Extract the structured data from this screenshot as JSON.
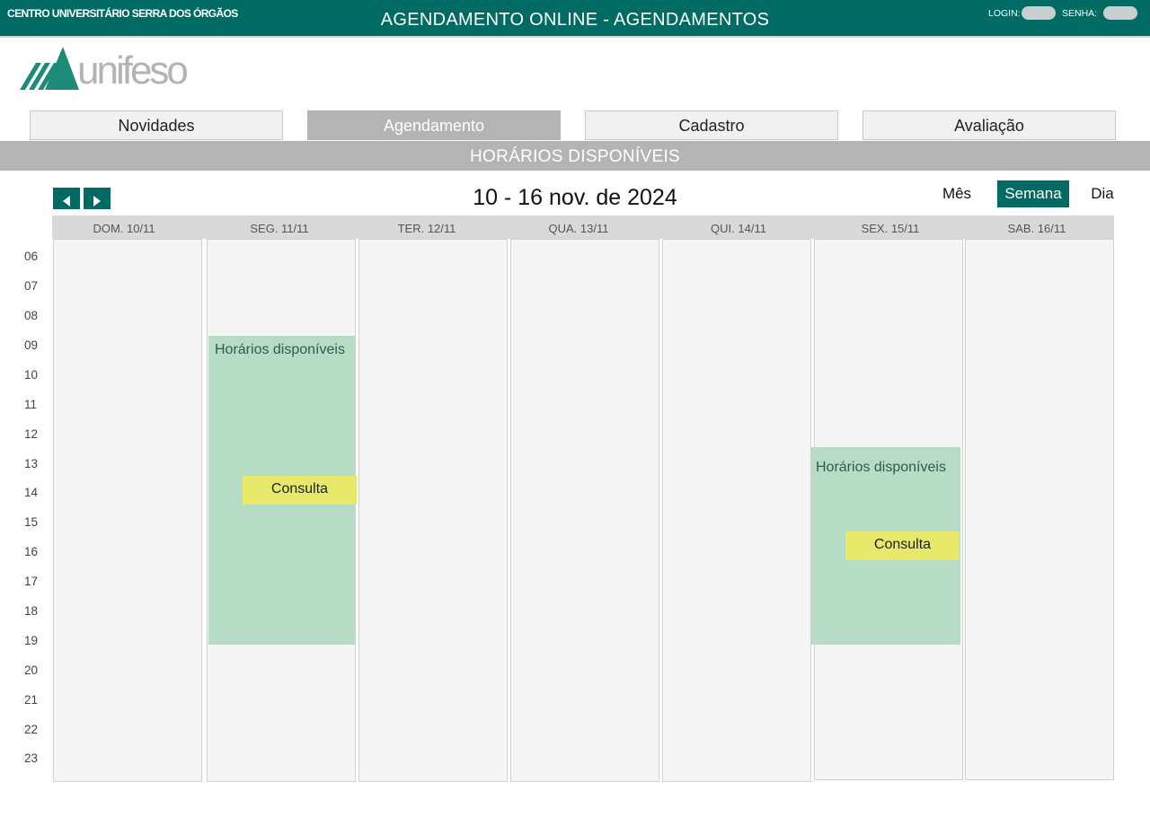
{
  "header": {
    "institution": "CENTRO UNIVERSITÁRIO SERRA DOS ÓRGÃOS",
    "title": "AGENDAMENTO ONLINE  -  AGENDAMENTOS",
    "login_label": "LOGIN:",
    "password_label": "SENHA:",
    "brand_color": "#006b63"
  },
  "logo": {
    "text": "unifeso"
  },
  "nav": {
    "tabs": [
      {
        "label": "Novidades",
        "active": false
      },
      {
        "label": "Agendamento",
        "active": true
      },
      {
        "label": "Cadastro",
        "active": false
      },
      {
        "label": "Avaliação",
        "active": false
      }
    ]
  },
  "section": {
    "title": "HORÁRIOS DISPONÍVEIS"
  },
  "calendar": {
    "range_title": "10 - 16 nov. de 2024",
    "views": [
      {
        "label": "Mês",
        "active": false
      },
      {
        "label": "Semana",
        "active": true
      },
      {
        "label": "Dia",
        "active": false
      }
    ],
    "days": [
      "DOM. 10/11",
      "SEG. 11/11",
      "TER. 12/11",
      "QUA. 13/11",
      "QUI. 14/11",
      "SEX. 15/11",
      "SAB. 16/11"
    ],
    "hours": [
      "06",
      "07",
      "08",
      "09",
      "10",
      "11",
      "12",
      "13",
      "14",
      "15",
      "16",
      "17",
      "18",
      "19",
      "20",
      "21",
      "22",
      "23"
    ],
    "availability": [
      {
        "day": "SEG. 11/11",
        "label": "Horários disponíveis",
        "event": "Consulta"
      },
      {
        "day": "SEX. 15/11",
        "label": "Horários disponíveis",
        "event": "Consulta"
      }
    ],
    "availability_color": "#b6dcc6",
    "event_color": "#e8e86a"
  }
}
